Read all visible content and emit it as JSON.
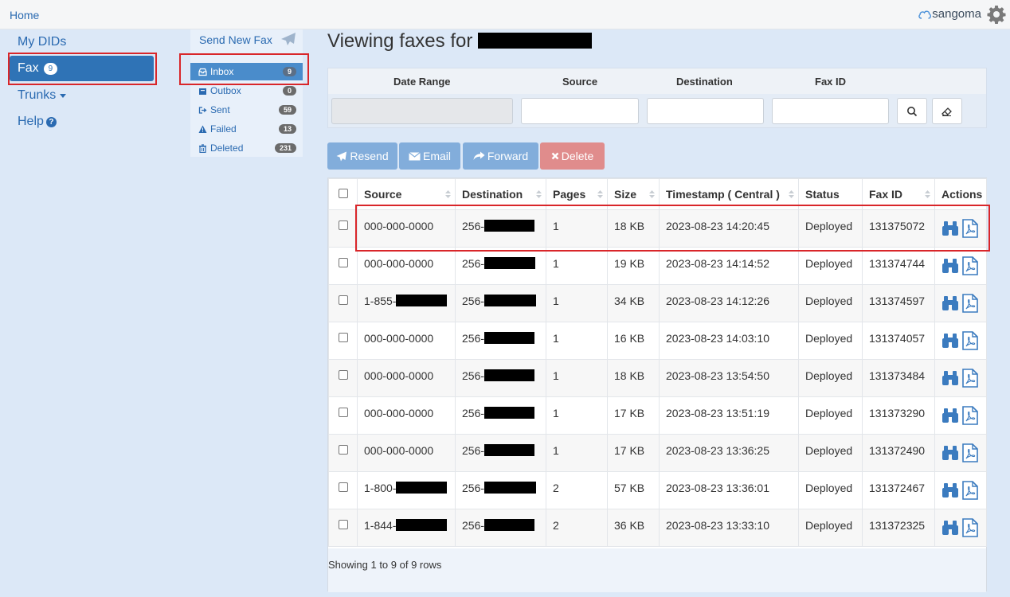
{
  "topbar": {
    "home": "Home",
    "brand": "sangoma"
  },
  "nav": {
    "my_dids": "My DIDs",
    "fax": "Fax",
    "fax_badge": "9",
    "trunks": "Trunks",
    "help": "Help"
  },
  "subnav": {
    "send_new_fax": "Send New Fax",
    "items": [
      {
        "label": "Inbox",
        "count": "9",
        "icon": "inbox-icon"
      },
      {
        "label": "Outbox",
        "count": "0",
        "icon": "outbox-icon"
      },
      {
        "label": "Sent",
        "count": "59",
        "icon": "sent-icon"
      },
      {
        "label": "Failed",
        "count": "13",
        "icon": "warning-icon"
      },
      {
        "label": "Deleted",
        "count": "231",
        "icon": "trash-icon"
      }
    ]
  },
  "page": {
    "title": "Viewing faxes for"
  },
  "filter": {
    "labels": {
      "date_range": "Date Range",
      "source": "Source",
      "destination": "Destination",
      "fax_id": "Fax ID"
    },
    "values": {
      "date_range": "",
      "source": "",
      "destination": "",
      "fax_id": ""
    }
  },
  "actions": {
    "resend": "Resend",
    "email": "Email",
    "forward": "Forward",
    "delete": "Delete"
  },
  "table": {
    "headers": {
      "source": "Source",
      "destination": "Destination",
      "pages": "Pages",
      "size": "Size",
      "timestamp": "Timestamp ( Central )",
      "status": "Status",
      "fax_id": "Fax ID",
      "actions": "Actions"
    },
    "rows": [
      {
        "source": "000-000-0000",
        "source_redacted": false,
        "destination": "256-",
        "pages": "1",
        "size": "18 KB",
        "timestamp": "2023-08-23 14:20:45",
        "status": "Deployed",
        "fax_id": "131375072"
      },
      {
        "source": "000-000-0000",
        "source_redacted": false,
        "destination": "256-",
        "pages": "1",
        "size": "19 KB",
        "timestamp": "2023-08-23 14:14:52",
        "status": "Deployed",
        "fax_id": "131374744"
      },
      {
        "source": "1-855-",
        "source_redacted": true,
        "destination": "256-",
        "pages": "1",
        "size": "34 KB",
        "timestamp": "2023-08-23 14:12:26",
        "status": "Deployed",
        "fax_id": "131374597"
      },
      {
        "source": "000-000-0000",
        "source_redacted": false,
        "destination": "256-",
        "pages": "1",
        "size": "16 KB",
        "timestamp": "2023-08-23 14:03:10",
        "status": "Deployed",
        "fax_id": "131374057"
      },
      {
        "source": "000-000-0000",
        "source_redacted": false,
        "destination": "256-",
        "pages": "1",
        "size": "18 KB",
        "timestamp": "2023-08-23 13:54:50",
        "status": "Deployed",
        "fax_id": "131373484"
      },
      {
        "source": "000-000-0000",
        "source_redacted": false,
        "destination": "256-",
        "pages": "1",
        "size": "17 KB",
        "timestamp": "2023-08-23 13:51:19",
        "status": "Deployed",
        "fax_id": "131373290"
      },
      {
        "source": "000-000-0000",
        "source_redacted": false,
        "destination": "256-",
        "pages": "1",
        "size": "17 KB",
        "timestamp": "2023-08-23 13:36:25",
        "status": "Deployed",
        "fax_id": "131372490"
      },
      {
        "source": "1-800-",
        "source_redacted": true,
        "destination": "256-",
        "pages": "2",
        "size": "57 KB",
        "timestamp": "2023-08-23 13:36:01",
        "status": "Deployed",
        "fax_id": "131372467"
      },
      {
        "source": "1-844-",
        "source_redacted": true,
        "destination": "256-",
        "pages": "2",
        "size": "36 KB",
        "timestamp": "2023-08-23 13:33:10",
        "status": "Deployed",
        "fax_id": "131372325"
      }
    ],
    "footer": "Showing 1 to 9 of 9 rows"
  },
  "colors": {
    "accent": "#2f73b6",
    "highlight": "#d9262a",
    "icon": "#3b7bbf"
  }
}
